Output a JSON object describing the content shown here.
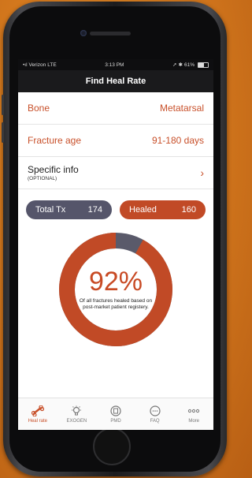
{
  "statusbar": {
    "carrier": "Verizon",
    "network": "LTE",
    "time": "3:13 PM",
    "battery": "61%"
  },
  "navbar": {
    "title": "Find Heal Rate"
  },
  "rows": [
    {
      "label": "Bone",
      "value": "Metatarsal"
    },
    {
      "label": "Fracture age",
      "value": "91-180 days"
    }
  ],
  "specific": {
    "label": "Specific info",
    "sublabel": "(OPTIONAL)"
  },
  "pills": {
    "total": {
      "label": "Total Tx",
      "value": "174"
    },
    "healed": {
      "label": "Healed",
      "value": "160"
    }
  },
  "donut": {
    "percent_text": "92%",
    "fraction": 0.92,
    "caption": "Of all fractures healed based on post-market patient registery."
  },
  "tabs": [
    {
      "label": "Heal rate",
      "icon": "bone-icon"
    },
    {
      "label": "EXOGEN",
      "icon": "bulb-icon"
    },
    {
      "label": "PMD",
      "icon": "document-icon"
    },
    {
      "label": "FAQ",
      "icon": "chat-icon"
    },
    {
      "label": "More",
      "icon": "more-icon"
    }
  ],
  "colors": {
    "accent": "#c8502a",
    "total_pill": "#55556a",
    "ring_remainder": "#5a5a6a"
  }
}
